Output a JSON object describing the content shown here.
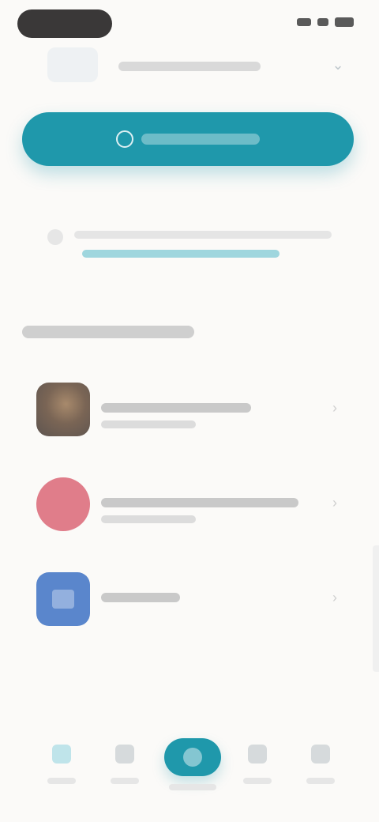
{
  "status_bar": {
    "icons": [
      "signal-icon",
      "wifi-icon",
      "battery-icon"
    ]
  },
  "header": {
    "avatar_icon": "avatar",
    "chevron_icon": "chevron-down-icon"
  },
  "cta": {
    "icon": "plus-circle-icon"
  },
  "info": {
    "icon": "info-icon"
  },
  "list": {
    "items": [
      {
        "thumb": "photo",
        "chevron_icon": "chevron-right-icon"
      },
      {
        "thumb": "pink-circle",
        "chevron_icon": "chevron-right-icon"
      },
      {
        "thumb": "blue-square",
        "chevron_icon": "chevron-right-icon"
      }
    ]
  },
  "bottom_nav": {
    "items": [
      {
        "icon": "home-icon",
        "active": true
      },
      {
        "icon": "grid-icon",
        "active": false
      },
      {
        "icon": "center-action-icon",
        "active": false
      },
      {
        "icon": "chat-icon",
        "active": false
      },
      {
        "icon": "profile-icon",
        "active": false
      }
    ]
  },
  "colors": {
    "accent": "#1f98ab",
    "background": "#fbfaf8",
    "pink": "#e07d8a",
    "blue": "#5a86cc"
  }
}
